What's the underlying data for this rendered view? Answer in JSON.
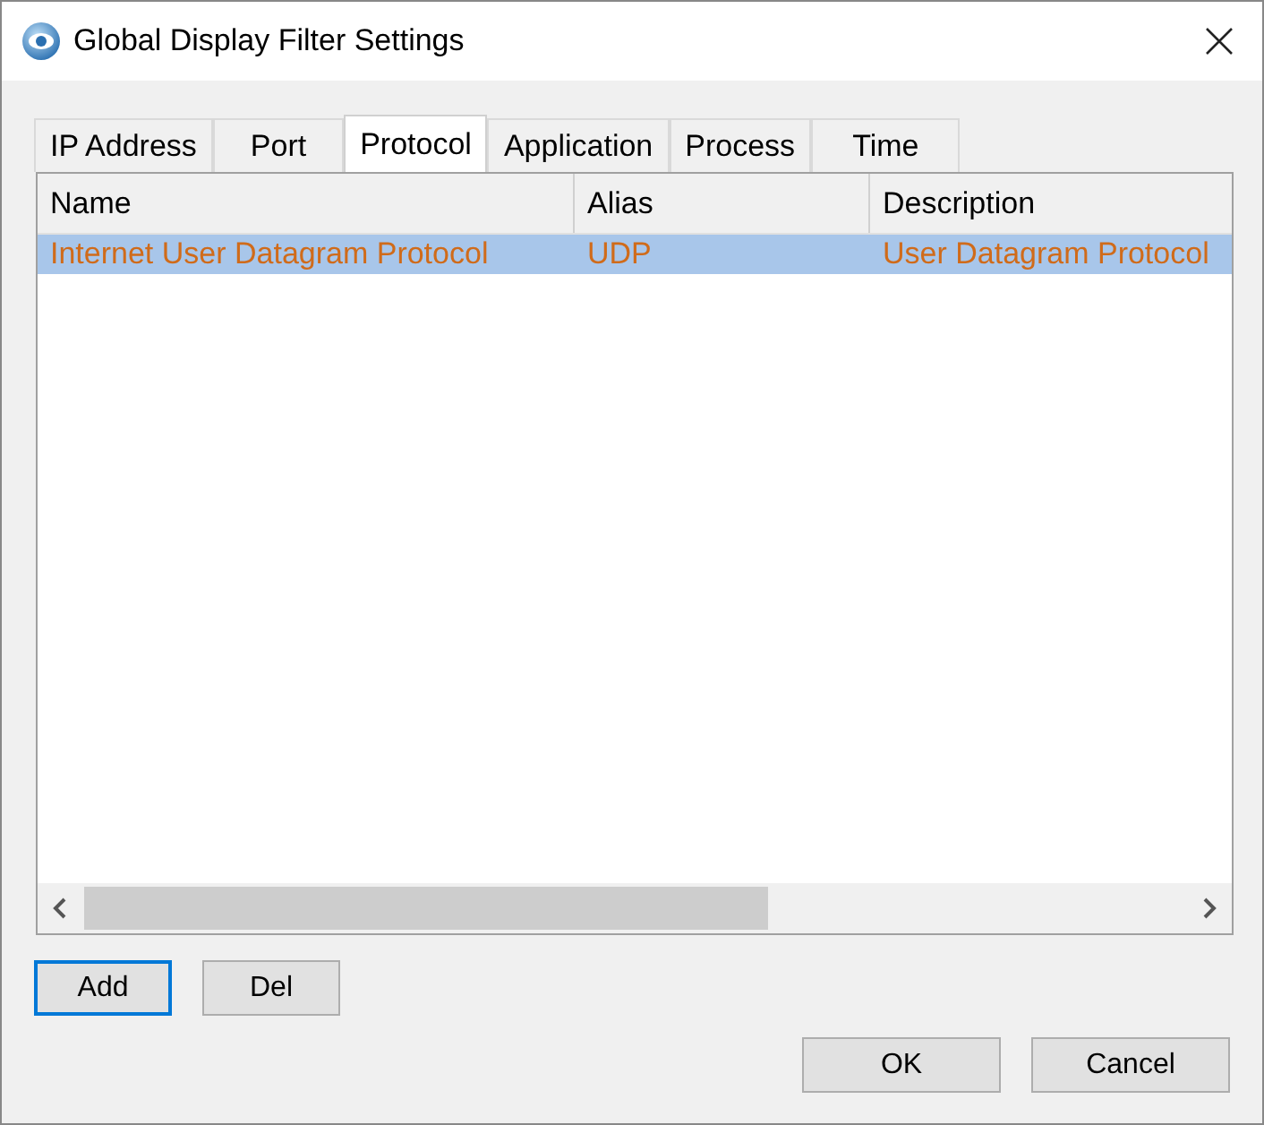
{
  "window": {
    "title": "Global Display Filter Settings"
  },
  "tabs": [
    {
      "label": "IP Address",
      "selected": false
    },
    {
      "label": "Port",
      "selected": false
    },
    {
      "label": "Protocol",
      "selected": true
    },
    {
      "label": "Application",
      "selected": false
    },
    {
      "label": "Process",
      "selected": false
    },
    {
      "label": "Time",
      "selected": false
    }
  ],
  "table": {
    "columns": [
      "Name",
      "Alias",
      "Description"
    ],
    "rows": [
      {
        "cells": [
          "Internet User Datagram Protocol",
          "UDP",
          "User Datagram Protocol"
        ],
        "selected": true
      }
    ]
  },
  "list_buttons": [
    {
      "label": "Add",
      "focused": true
    },
    {
      "label": "Del",
      "focused": false
    }
  ],
  "dialog_buttons": [
    {
      "label": "OK"
    },
    {
      "label": "Cancel"
    }
  ]
}
